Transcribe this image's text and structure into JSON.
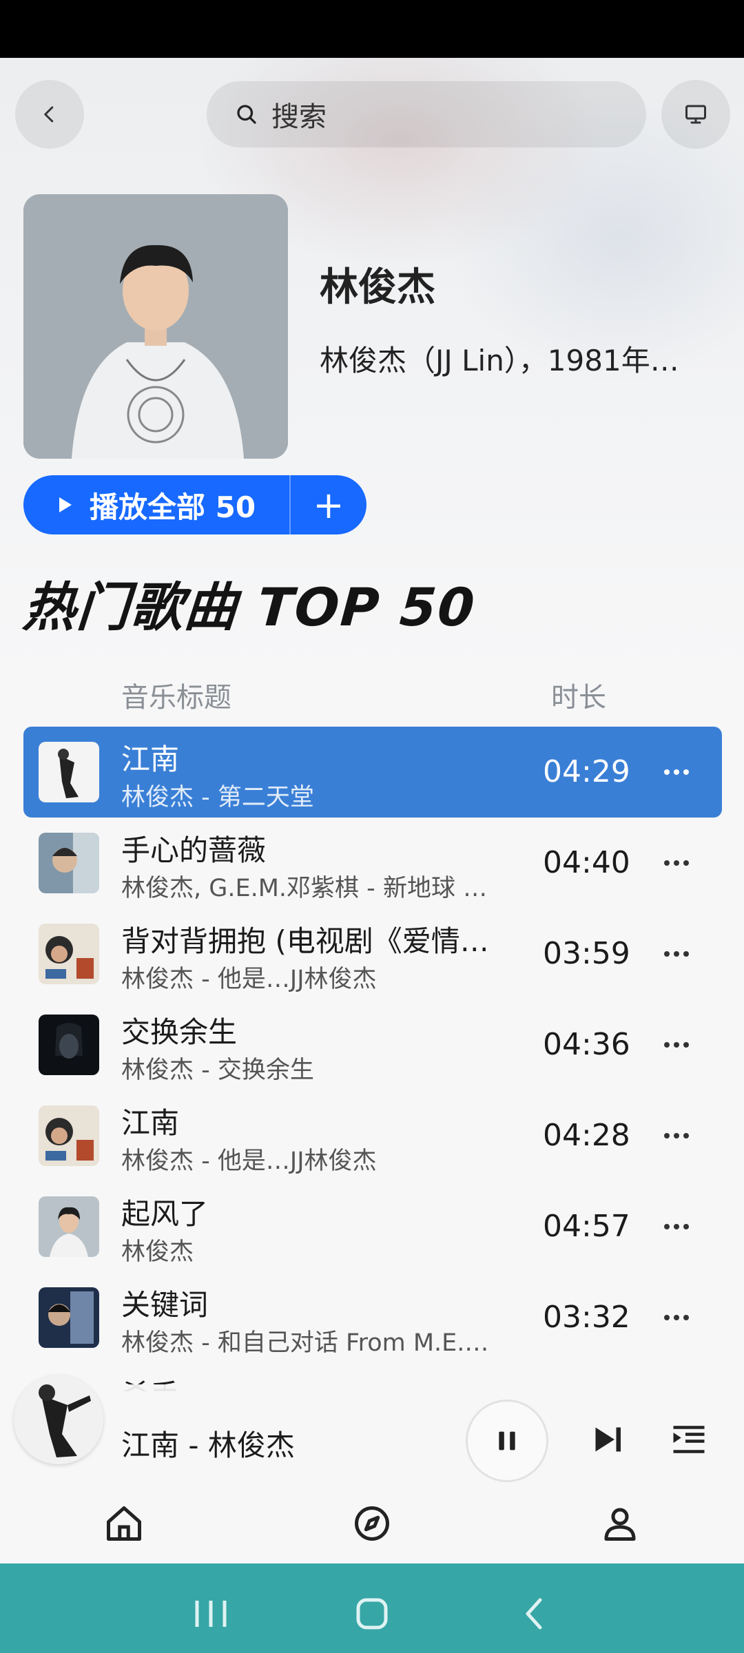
{
  "header": {
    "search_placeholder": "搜索",
    "icons": {
      "back": "back-arrow-icon",
      "search": "search-icon",
      "screen": "monitor-icon"
    }
  },
  "artist": {
    "name": "林俊杰",
    "description": "林俊杰（JJ Lin），1981年…"
  },
  "actions": {
    "play_all_label": "播放全部 50",
    "add_label": "+"
  },
  "section": {
    "title": "热门歌曲 TOP 50",
    "col_title": "音乐标题",
    "col_duration": "时长"
  },
  "songs": [
    {
      "title": "江南",
      "subtitle": "林俊杰 - 第二天堂",
      "duration": "04:29",
      "active": true
    },
    {
      "title": "手心的蔷薇",
      "subtitle": "林俊杰, G.E.M.邓紫棋 - 新地球 …",
      "duration": "04:40"
    },
    {
      "title": "背对背拥抱 (电视剧《爱情…",
      "subtitle": "林俊杰 - 他是…JJ林俊杰",
      "duration": "03:59"
    },
    {
      "title": "交换余生",
      "subtitle": "林俊杰 - 交换余生",
      "duration": "04:36"
    },
    {
      "title": "江南",
      "subtitle": "林俊杰 - 他是…JJ林俊杰",
      "duration": "04:28"
    },
    {
      "title": "起风了",
      "subtitle": "林俊杰",
      "duration": "04:57"
    },
    {
      "title": "关键词",
      "subtitle": "林俊杰 - 和自己对话 From M.E.…",
      "duration": "03:32"
    }
  ],
  "partial_song_title": "杀手",
  "player": {
    "now_playing": "江南 - 林俊杰",
    "state": "playing"
  },
  "tabs": [
    {
      "name": "home",
      "icon": "home-icon"
    },
    {
      "name": "discover",
      "icon": "compass-icon"
    },
    {
      "name": "profile",
      "icon": "user-icon"
    }
  ],
  "colors": {
    "accent": "#1769ff",
    "active_row": "#3a7fd6",
    "navbar": "#36a6a6"
  }
}
